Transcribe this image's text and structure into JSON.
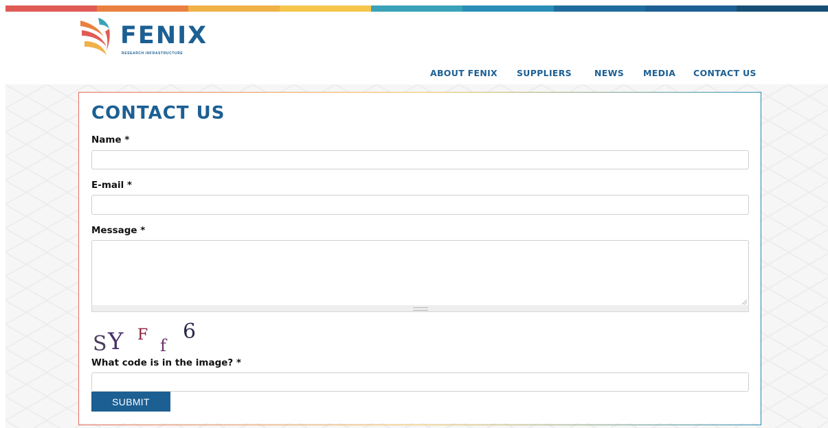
{
  "colors": {
    "brand": "#1c5f93",
    "top_bar": [
      "#e05b55",
      "#e9803f",
      "#f0b147",
      "#f5c64b",
      "#3aa2b8",
      "#2a8db6",
      "#1f6d9e",
      "#1c5f93",
      "#174e74"
    ]
  },
  "header": {
    "logo": {
      "name": "FENIX",
      "tagline": "RESEARCH INFRASTRUCTURE",
      "icon": "phoenix-logo-icon"
    },
    "nav": [
      "ABOUT FENIX",
      "SUPPLIERS",
      "NEWS",
      "MEDIA",
      "CONTACT US"
    ]
  },
  "form": {
    "title": "CONTACT US",
    "name_label": "Name *",
    "name_value": "",
    "email_label": "E-mail *",
    "email_value": "",
    "message_label": "Message *",
    "message_value": "",
    "captcha": {
      "characters": [
        "S",
        "Y",
        "F",
        "f",
        "6"
      ],
      "colors": [
        "#4a3a5c",
        "#4a2f6b",
        "#8a1f3c",
        "#6b2f6b",
        "#2a2a4a"
      ]
    },
    "captcha_label": "What code is in the image? *",
    "captcha_value": "",
    "submit_label": "SUBMIT"
  }
}
